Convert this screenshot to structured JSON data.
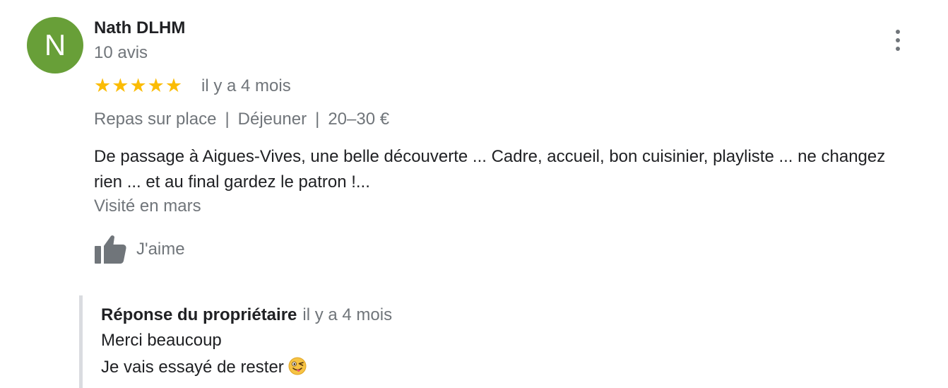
{
  "reviewer": {
    "initial": "N",
    "name": "Nath DLHM",
    "review_count": "10 avis",
    "avatar_color": "#689f38"
  },
  "review": {
    "rating": 5,
    "max_rating": 5,
    "time": "il y a 4 mois",
    "tags": [
      "Repas sur place",
      "Déjeuner",
      "20–30 €"
    ],
    "text": "De passage à Aigues-Vives, une belle découverte ... Cadre, accueil, bon cuisinier, playliste ... ne changez rien ... et au final gardez le patron !...",
    "visited": "Visité en mars",
    "like_label": "J'aime",
    "star_color": "#fbbc04",
    "menu_icon": "more-vert-icon"
  },
  "owner_response": {
    "title": "Réponse du propriétaire",
    "time": "il y a 4 mois",
    "line1": "Merci beaucoup",
    "line2": "Je vais essayé de rester",
    "emoji_icon": "winking-face-with-tongue-icon"
  }
}
